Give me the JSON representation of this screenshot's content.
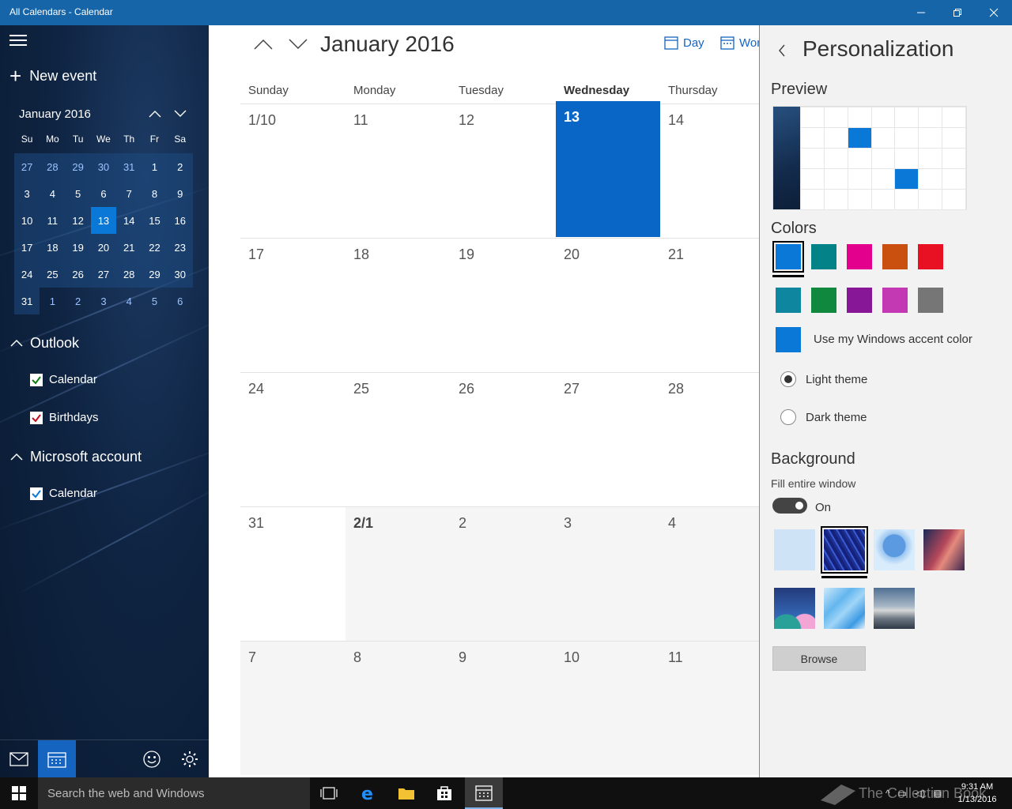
{
  "window": {
    "title": "All Calendars - Calendar"
  },
  "sidebar": {
    "new_event_label": "New event",
    "mini_calendar": {
      "title": "January 2016",
      "day_headers": [
        "Su",
        "Mo",
        "Tu",
        "We",
        "Th",
        "Fr",
        "Sa"
      ],
      "weeks": [
        [
          "27",
          "28",
          "29",
          "30",
          "31",
          "1",
          "2"
        ],
        [
          "3",
          "4",
          "5",
          "6",
          "7",
          "8",
          "9"
        ],
        [
          "10",
          "11",
          "12",
          "13",
          "14",
          "15",
          "16"
        ],
        [
          "17",
          "18",
          "19",
          "20",
          "21",
          "22",
          "23"
        ],
        [
          "24",
          "25",
          "26",
          "27",
          "28",
          "29",
          "30"
        ],
        [
          "31",
          "1",
          "2",
          "3",
          "4",
          "5",
          "6"
        ]
      ],
      "selected_day": "13"
    },
    "accounts": [
      {
        "name": "Outlook",
        "calendars": [
          {
            "label": "Calendar",
            "checked": true,
            "color": "#107c10"
          },
          {
            "label": "Birthdays",
            "checked": true,
            "color": "#c50f1f"
          }
        ]
      },
      {
        "name": "Microsoft account",
        "calendars": [
          {
            "label": "Calendar",
            "checked": true,
            "color": "#0a78d7"
          }
        ]
      }
    ]
  },
  "main": {
    "month_title": "January 2016",
    "views": [
      "Day",
      "Wor"
    ],
    "day_headers": [
      "Sunday",
      "Monday",
      "Tuesday",
      "Wednesday",
      "Thursday"
    ],
    "current_day_header": "Wednesday",
    "weeks": [
      [
        "1/10",
        "11",
        "12",
        "13",
        "14"
      ],
      [
        "17",
        "18",
        "19",
        "20",
        "21"
      ],
      [
        "24",
        "25",
        "26",
        "27",
        "28"
      ],
      [
        "31",
        "2/1",
        "2",
        "3",
        "4"
      ],
      [
        "7",
        "8",
        "9",
        "10",
        "11"
      ]
    ],
    "today": "13"
  },
  "personalization": {
    "title": "Personalization",
    "preview_heading": "Preview",
    "colors_heading": "Colors",
    "colors": [
      "#0a78d7",
      "#038387",
      "#e3008c",
      "#ca5010",
      "#e81123",
      "#0e86a0",
      "#10893e",
      "#881798",
      "#c239b3",
      "#767676"
    ],
    "selected_color": "#0a78d7",
    "accent_swatch_color": "#0a78d7",
    "accent_label": "Use my Windows accent color",
    "light_theme_label": "Light theme",
    "dark_theme_label": "Dark theme",
    "selected_theme": "Light theme",
    "background_heading": "Background",
    "fill_label": "Fill entire window",
    "toggle_state": "On",
    "browse_label": "Browse"
  },
  "taskbar": {
    "search_placeholder": "Search the web and Windows",
    "time": "9:31 AM",
    "date": "1/13/2016",
    "watermark": "The Collection Book"
  }
}
